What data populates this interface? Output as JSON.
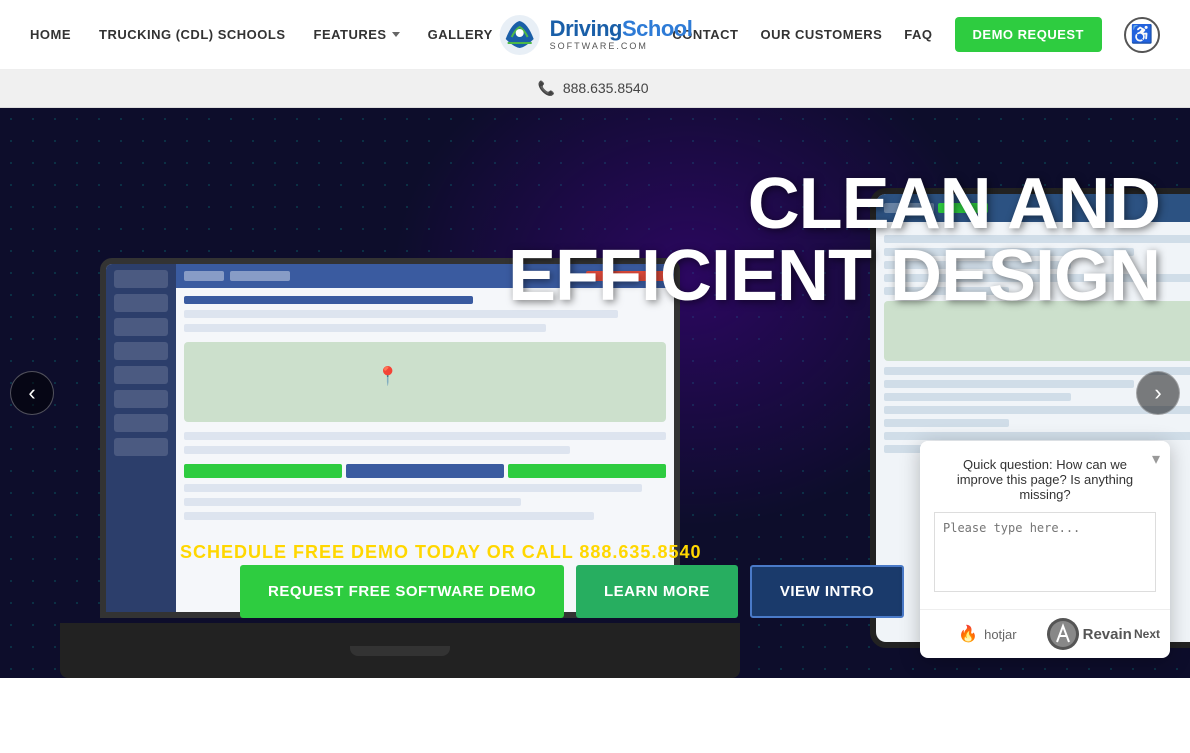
{
  "nav": {
    "links": [
      {
        "id": "home",
        "label": "HOME"
      },
      {
        "id": "trucking",
        "label": "TRUCKING (CDL) SCHOOLS"
      },
      {
        "id": "features",
        "label": "FEATURES"
      },
      {
        "id": "gallery",
        "label": "GALLERY"
      },
      {
        "id": "contact",
        "label": "CONTACT"
      },
      {
        "id": "our-customers",
        "label": "OUR CUSTOMERS"
      },
      {
        "id": "faq",
        "label": "FAQ"
      }
    ],
    "demo_btn": "DEMO REQUEST",
    "logo": {
      "main_text": "DrivingSchool",
      "accent_text": "Software",
      "sub_text": "SOFTWARE.COM"
    }
  },
  "phone": {
    "number": "888.635.8540",
    "icon": "📞"
  },
  "hero": {
    "title_line1": "CLEAN AND",
    "title_line2": "EFFICIENT DESIGN",
    "schedule_text": "SCHEDULE FREE DEMO TODAY OR CALL 888.635.8540",
    "btn_request": "REQUEST FREE SOFTWARE DEMO",
    "btn_learn": "LEARN MORE",
    "btn_intro": "VIEW INTRO"
  },
  "hotjar": {
    "question": "Quick question: How can we improve this page? Is anything missing?",
    "placeholder": "Please type here...",
    "hotjar_label": "hotjar",
    "revain_label": "Revain",
    "next_label": "Next",
    "close_icon": "▾"
  },
  "accessibility": {
    "icon": "♿",
    "label": "Accessibility"
  }
}
